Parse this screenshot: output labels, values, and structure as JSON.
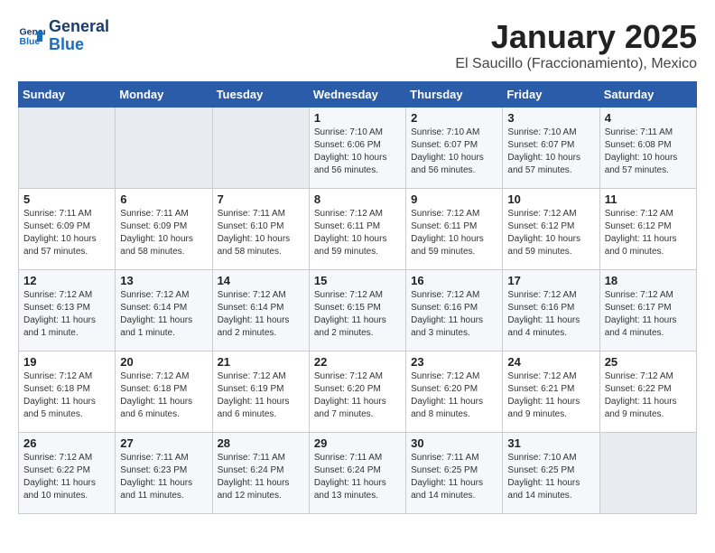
{
  "header": {
    "logo_line1": "General",
    "logo_line2": "Blue",
    "title": "January 2025",
    "subtitle": "El Saucillo (Fraccionamiento), Mexico"
  },
  "weekdays": [
    "Sunday",
    "Monday",
    "Tuesday",
    "Wednesday",
    "Thursday",
    "Friday",
    "Saturday"
  ],
  "weeks": [
    [
      {
        "day": "",
        "info": ""
      },
      {
        "day": "",
        "info": ""
      },
      {
        "day": "",
        "info": ""
      },
      {
        "day": "1",
        "info": "Sunrise: 7:10 AM\nSunset: 6:06 PM\nDaylight: 10 hours\nand 56 minutes."
      },
      {
        "day": "2",
        "info": "Sunrise: 7:10 AM\nSunset: 6:07 PM\nDaylight: 10 hours\nand 56 minutes."
      },
      {
        "day": "3",
        "info": "Sunrise: 7:10 AM\nSunset: 6:07 PM\nDaylight: 10 hours\nand 57 minutes."
      },
      {
        "day": "4",
        "info": "Sunrise: 7:11 AM\nSunset: 6:08 PM\nDaylight: 10 hours\nand 57 minutes."
      }
    ],
    [
      {
        "day": "5",
        "info": "Sunrise: 7:11 AM\nSunset: 6:09 PM\nDaylight: 10 hours\nand 57 minutes."
      },
      {
        "day": "6",
        "info": "Sunrise: 7:11 AM\nSunset: 6:09 PM\nDaylight: 10 hours\nand 58 minutes."
      },
      {
        "day": "7",
        "info": "Sunrise: 7:11 AM\nSunset: 6:10 PM\nDaylight: 10 hours\nand 58 minutes."
      },
      {
        "day": "8",
        "info": "Sunrise: 7:12 AM\nSunset: 6:11 PM\nDaylight: 10 hours\nand 59 minutes."
      },
      {
        "day": "9",
        "info": "Sunrise: 7:12 AM\nSunset: 6:11 PM\nDaylight: 10 hours\nand 59 minutes."
      },
      {
        "day": "10",
        "info": "Sunrise: 7:12 AM\nSunset: 6:12 PM\nDaylight: 10 hours\nand 59 minutes."
      },
      {
        "day": "11",
        "info": "Sunrise: 7:12 AM\nSunset: 6:12 PM\nDaylight: 11 hours\nand 0 minutes."
      }
    ],
    [
      {
        "day": "12",
        "info": "Sunrise: 7:12 AM\nSunset: 6:13 PM\nDaylight: 11 hours\nand 1 minute."
      },
      {
        "day": "13",
        "info": "Sunrise: 7:12 AM\nSunset: 6:14 PM\nDaylight: 11 hours\nand 1 minute."
      },
      {
        "day": "14",
        "info": "Sunrise: 7:12 AM\nSunset: 6:14 PM\nDaylight: 11 hours\nand 2 minutes."
      },
      {
        "day": "15",
        "info": "Sunrise: 7:12 AM\nSunset: 6:15 PM\nDaylight: 11 hours\nand 2 minutes."
      },
      {
        "day": "16",
        "info": "Sunrise: 7:12 AM\nSunset: 6:16 PM\nDaylight: 11 hours\nand 3 minutes."
      },
      {
        "day": "17",
        "info": "Sunrise: 7:12 AM\nSunset: 6:16 PM\nDaylight: 11 hours\nand 4 minutes."
      },
      {
        "day": "18",
        "info": "Sunrise: 7:12 AM\nSunset: 6:17 PM\nDaylight: 11 hours\nand 4 minutes."
      }
    ],
    [
      {
        "day": "19",
        "info": "Sunrise: 7:12 AM\nSunset: 6:18 PM\nDaylight: 11 hours\nand 5 minutes."
      },
      {
        "day": "20",
        "info": "Sunrise: 7:12 AM\nSunset: 6:18 PM\nDaylight: 11 hours\nand 6 minutes."
      },
      {
        "day": "21",
        "info": "Sunrise: 7:12 AM\nSunset: 6:19 PM\nDaylight: 11 hours\nand 6 minutes."
      },
      {
        "day": "22",
        "info": "Sunrise: 7:12 AM\nSunset: 6:20 PM\nDaylight: 11 hours\nand 7 minutes."
      },
      {
        "day": "23",
        "info": "Sunrise: 7:12 AM\nSunset: 6:20 PM\nDaylight: 11 hours\nand 8 minutes."
      },
      {
        "day": "24",
        "info": "Sunrise: 7:12 AM\nSunset: 6:21 PM\nDaylight: 11 hours\nand 9 minutes."
      },
      {
        "day": "25",
        "info": "Sunrise: 7:12 AM\nSunset: 6:22 PM\nDaylight: 11 hours\nand 9 minutes."
      }
    ],
    [
      {
        "day": "26",
        "info": "Sunrise: 7:12 AM\nSunset: 6:22 PM\nDaylight: 11 hours\nand 10 minutes."
      },
      {
        "day": "27",
        "info": "Sunrise: 7:11 AM\nSunset: 6:23 PM\nDaylight: 11 hours\nand 11 minutes."
      },
      {
        "day": "28",
        "info": "Sunrise: 7:11 AM\nSunset: 6:24 PM\nDaylight: 11 hours\nand 12 minutes."
      },
      {
        "day": "29",
        "info": "Sunrise: 7:11 AM\nSunset: 6:24 PM\nDaylight: 11 hours\nand 13 minutes."
      },
      {
        "day": "30",
        "info": "Sunrise: 7:11 AM\nSunset: 6:25 PM\nDaylight: 11 hours\nand 14 minutes."
      },
      {
        "day": "31",
        "info": "Sunrise: 7:10 AM\nSunset: 6:25 PM\nDaylight: 11 hours\nand 14 minutes."
      },
      {
        "day": "",
        "info": ""
      }
    ]
  ]
}
